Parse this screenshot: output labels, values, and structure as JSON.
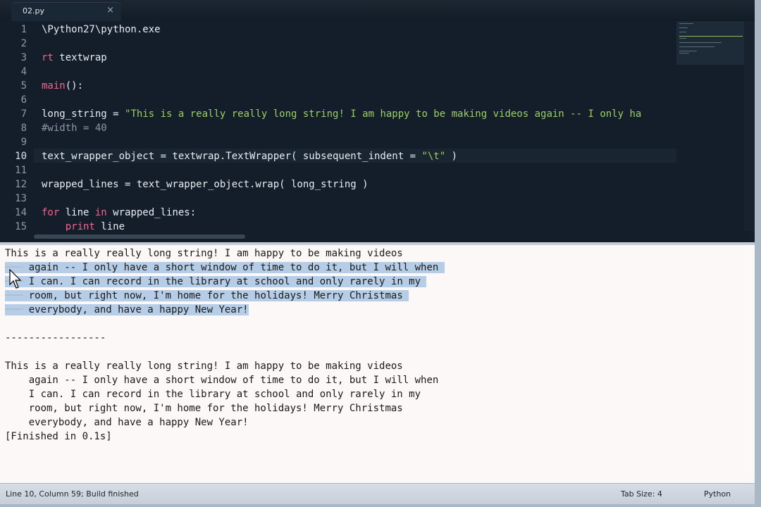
{
  "tab": {
    "title": "02.py",
    "close_glyph": "×"
  },
  "editor": {
    "line_numbers": [
      "1",
      "2",
      "3",
      "4",
      "5",
      "6",
      "7",
      "8",
      "9",
      "10",
      "11",
      "12",
      "13",
      "14",
      "15"
    ],
    "current_line": "10",
    "lines": {
      "l1": "\\Python27\\python.exe",
      "l3a": "rt ",
      "l3b": "textwrap",
      "l5a": "main",
      "l5b": "():",
      "l7a": "long_string = ",
      "l7b": "\"This is a really really long string! I am happy to be making videos again -- I only ha",
      "l8": "#width = 40",
      "l10a": "text_wrapper_object = textwrap.TextWrapper( subsequent_indent = ",
      "l10b": "\"\\t\"",
      "l10c": " )",
      "l12": "wrapped_lines = text_wrapper_object.wrap( long_string )",
      "l14a": "for",
      "l14b": " line ",
      "l14c": "in",
      "l14d": " wrapped_lines:",
      "l15a": "    ",
      "l15b": "print",
      "l15c": " line"
    }
  },
  "output": {
    "block1": [
      "This is a really really long string! I am happy to be making videos",
      "again -- I only have a short window of time to do it, but I will when",
      "I can. I can record in the library at school and only rarely in my",
      "room, but right now, I'm home for the holidays! Merry Christmas",
      "everybody, and have a happy New Year!"
    ],
    "separator": "-----------------",
    "block2": [
      "This is a really really long string! I am happy to be making videos",
      "    again -- I only have a short window of time to do it, but I will when",
      "    I can. I can record in the library at school and only rarely in my",
      "    room, but right now, I'm home for the holidays! Merry Christmas",
      "    everybody, and have a happy New Year!"
    ],
    "finished": "[Finished in 0.1s]"
  },
  "status": {
    "left": "Line 10, Column 59; Build finished",
    "tab_size": "Tab Size: 4",
    "syntax": "Python"
  },
  "colors": {
    "editor_bg": "#141e2a",
    "keyword": "#f7638a",
    "string": "#9ccf63",
    "comment": "#8d98a4",
    "selection": "#b5cde6"
  }
}
